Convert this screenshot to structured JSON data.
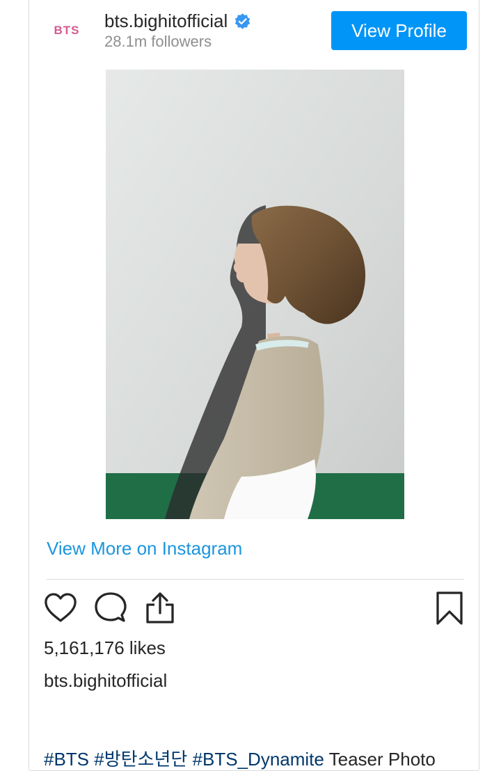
{
  "header": {
    "avatar_text": "BTS",
    "username": "bts.bighitofficial",
    "followers": "28.1m followers",
    "view_profile_label": "View Profile"
  },
  "view_more_label": "View More on Instagram",
  "likes": "5,161,176 likes",
  "caption": {
    "username": "bts.bighitofficial",
    "hashtags": [
      "#BTS",
      "#방탄소년단",
      "#BTS_Dynamite"
    ],
    "text": "Teaser Photo"
  },
  "icons": [
    "verified-badge-icon",
    "heart-icon",
    "comment-icon",
    "share-icon",
    "bookmark-icon"
  ],
  "colors": {
    "button_blue": "#0095f6",
    "link_blue": "#1b95e0",
    "hashtag": "#00376b",
    "text": "#262626",
    "muted": "#8e8e8e",
    "avatar_pink": "#d45a91"
  }
}
